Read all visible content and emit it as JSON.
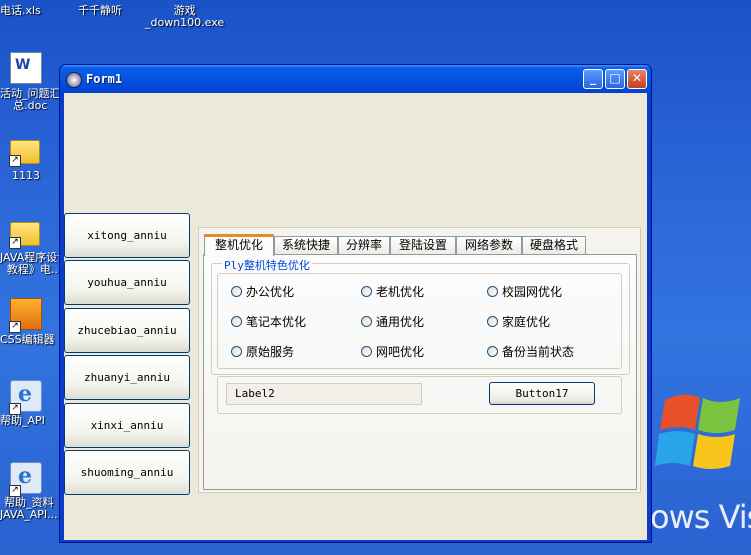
{
  "desktop": {
    "icons": [
      {
        "label": "电话.xls"
      },
      {
        "label": "千千静听"
      },
      {
        "label": "游戏\n_down100.exe"
      },
      {
        "label": "活动_问题汇\n总.doc"
      },
      {
        "label": "1113"
      },
      {
        "label": "JAVA程序设计\n教程》电..."
      },
      {
        "label": "CSS编辑器"
      },
      {
        "label": "帮助_API"
      },
      {
        "label": "帮助_资料\nJAVA_API..."
      }
    ],
    "wallpaper_text": "ows Vis"
  },
  "window": {
    "title": "Form1",
    "controls": {
      "minimize": "_",
      "maximize": "□",
      "close": "✕"
    },
    "side_buttons": [
      "xitong_anniu",
      "youhua_anniu",
      "zhucebiao_anniu",
      "zhuanyi_anniu",
      "xinxi_anniu",
      "shuoming_anniu"
    ],
    "tabs": [
      "整机优化",
      "系统快捷",
      "分辨率",
      "登陆设置",
      "网络参数",
      "硬盘格式"
    ],
    "active_tab": 0,
    "group_title": "Ply整机特色优化",
    "radios": [
      [
        "办公优化",
        "老机优化",
        "校园网优化"
      ],
      [
        "笔记本优化",
        "通用优化",
        "家庭优化"
      ],
      [
        "原始服务",
        "网吧优化",
        "备份当前状态"
      ]
    ],
    "label2": "Label2",
    "button17": "Button17"
  },
  "colors": {
    "titlebar": "#0554e2",
    "client": "#ece9d8",
    "tab_accent": "#e68b2c",
    "group_title": "#0046d5"
  }
}
